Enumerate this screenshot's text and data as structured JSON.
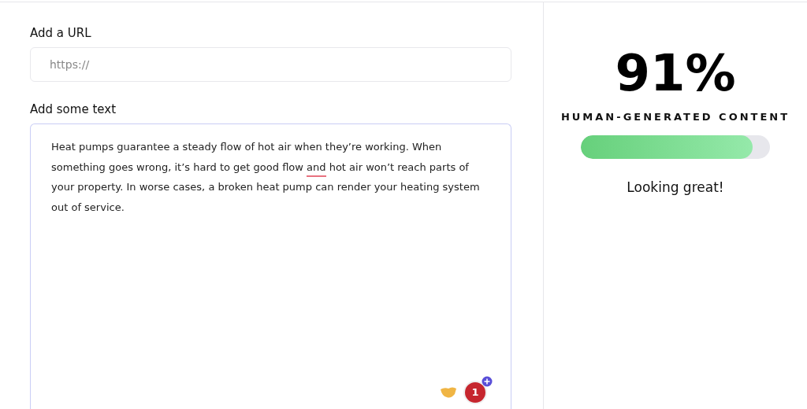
{
  "url_field": {
    "label": "Add a URL",
    "placeholder": "https://"
  },
  "text_field": {
    "label": "Add some text",
    "segments": [
      {
        "text": "Heat pumps guarantee a steady flow of hot air when they’re working. When something goes wrong, it’s hard to get good flow ",
        "flagged": false
      },
      {
        "text": "and",
        "flagged": true
      },
      {
        "text": " hot air won’t reach parts of your property. In worse cases, a broken heat pump can render your heating system out of service.",
        "flagged": false
      }
    ],
    "badge_count": "1"
  },
  "result": {
    "score": "91%",
    "caption": "HUMAN-GENERATED CONTENT",
    "level": 0.91,
    "verdict": "Looking great!"
  }
}
